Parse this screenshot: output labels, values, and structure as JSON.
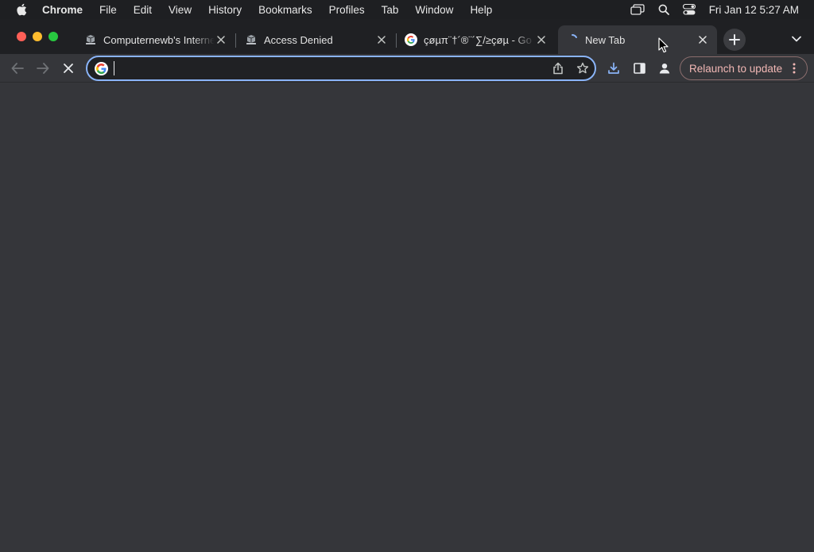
{
  "menubar": {
    "app_name": "Chrome",
    "items": [
      "File",
      "Edit",
      "View",
      "History",
      "Bookmarks",
      "Profiles",
      "Tab",
      "Window",
      "Help"
    ],
    "clock": "Fri Jan 12  5:27 AM"
  },
  "tabs": [
    {
      "title": "Computernewb's Interne",
      "favicon": "computernewb-icon"
    },
    {
      "title": "Access Denied",
      "favicon": "computernewb-icon"
    },
    {
      "title": "çøµπ¨†´®¨´∑/≥çøµ - Go",
      "favicon": "google-icon"
    },
    {
      "title": "New Tab",
      "favicon": "loading-spinner-icon",
      "active": true
    }
  ],
  "omnibox": {
    "value": "",
    "placeholder": ""
  },
  "toolbar": {
    "relaunch_label": "Relaunch to update"
  },
  "colors": {
    "frame": "#1f2023",
    "toolbar": "#35363a",
    "omnibox_focus": "#8ab4f8",
    "relaunch_text": "#f2b8b5"
  }
}
